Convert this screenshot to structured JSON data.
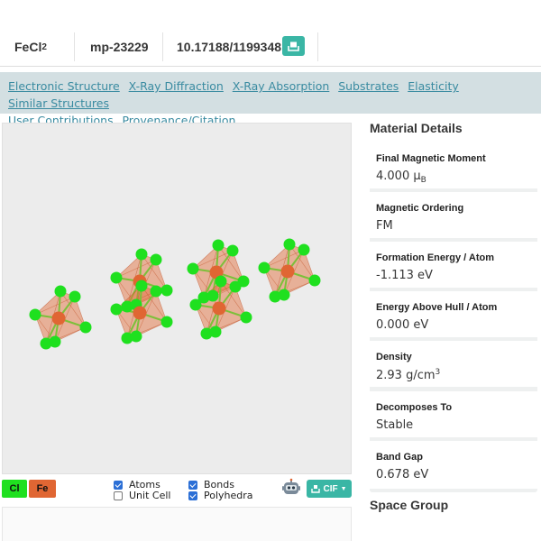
{
  "header": {
    "formula_main": "FeCl",
    "formula_sub": "2",
    "material_id": "mp-23229",
    "doi": "10.17188/1199348",
    "cite_icon": "bookmark-icon"
  },
  "nav": {
    "links": [
      "Electronic Structure",
      "X-Ray Diffraction",
      "X-Ray Absorption",
      "Substrates",
      "Elasticity",
      "Similar Structures",
      "User Contributions",
      "Provenance/Citation"
    ]
  },
  "legend": {
    "cl": "Cl",
    "fe": "Fe",
    "cl_color": "#1fe01f",
    "fe_color": "#e06633"
  },
  "toggles": {
    "atoms": {
      "label": "Atoms",
      "checked": true
    },
    "unit_cell": {
      "label": "Unit Cell",
      "checked": false
    },
    "bonds": {
      "label": "Bonds",
      "checked": true
    },
    "polyhedra": {
      "label": "Polyhedra",
      "checked": true
    }
  },
  "download": {
    "label": "CIF",
    "icon": "download-icon",
    "robot_icon": "robot-icon"
  },
  "details": {
    "title": "Material Details",
    "items": [
      {
        "label": "Final Magnetic Moment",
        "value": "4.000 μ",
        "value_sub": "B"
      },
      {
        "label": "Magnetic Ordering",
        "value": "FM"
      },
      {
        "label": "Formation Energy / Atom",
        "value": "-1.113 eV"
      },
      {
        "label": "Energy Above Hull / Atom",
        "value": "0.000 eV"
      },
      {
        "label": "Density",
        "value": "2.93 g/cm",
        "value_sup": "3"
      },
      {
        "label": "Decomposes To",
        "value": "Stable"
      },
      {
        "label": "Band Gap",
        "value": "0.678 eV"
      }
    ]
  },
  "space_group": {
    "title": "Space Group"
  },
  "colors": {
    "accent": "#3ab6a5",
    "nav_bg": "#d3dfe2",
    "link": "#3a8ba1"
  }
}
